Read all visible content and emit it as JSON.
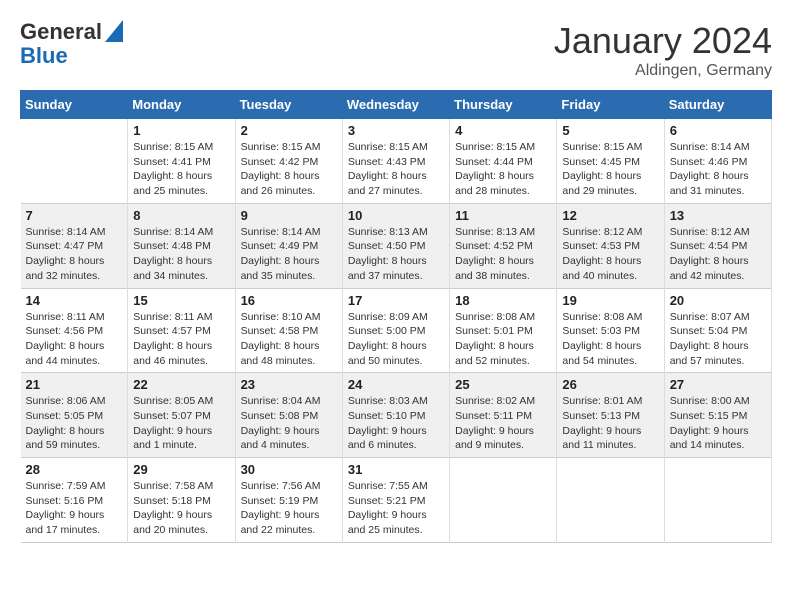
{
  "logo": {
    "general": "General",
    "blue": "Blue"
  },
  "header": {
    "month": "January 2024",
    "location": "Aldingen, Germany"
  },
  "days_of_week": [
    "Sunday",
    "Monday",
    "Tuesday",
    "Wednesday",
    "Thursday",
    "Friday",
    "Saturday"
  ],
  "weeks": [
    {
      "row_class": "week-row-1",
      "days": [
        {
          "num": "",
          "info": ""
        },
        {
          "num": "1",
          "info": "Sunrise: 8:15 AM\nSunset: 4:41 PM\nDaylight: 8 hours\nand 25 minutes."
        },
        {
          "num": "2",
          "info": "Sunrise: 8:15 AM\nSunset: 4:42 PM\nDaylight: 8 hours\nand 26 minutes."
        },
        {
          "num": "3",
          "info": "Sunrise: 8:15 AM\nSunset: 4:43 PM\nDaylight: 8 hours\nand 27 minutes."
        },
        {
          "num": "4",
          "info": "Sunrise: 8:15 AM\nSunset: 4:44 PM\nDaylight: 8 hours\nand 28 minutes."
        },
        {
          "num": "5",
          "info": "Sunrise: 8:15 AM\nSunset: 4:45 PM\nDaylight: 8 hours\nand 29 minutes."
        },
        {
          "num": "6",
          "info": "Sunrise: 8:14 AM\nSunset: 4:46 PM\nDaylight: 8 hours\nand 31 minutes."
        }
      ]
    },
    {
      "row_class": "week-row-2",
      "days": [
        {
          "num": "7",
          "info": "Sunrise: 8:14 AM\nSunset: 4:47 PM\nDaylight: 8 hours\nand 32 minutes."
        },
        {
          "num": "8",
          "info": "Sunrise: 8:14 AM\nSunset: 4:48 PM\nDaylight: 8 hours\nand 34 minutes."
        },
        {
          "num": "9",
          "info": "Sunrise: 8:14 AM\nSunset: 4:49 PM\nDaylight: 8 hours\nand 35 minutes."
        },
        {
          "num": "10",
          "info": "Sunrise: 8:13 AM\nSunset: 4:50 PM\nDaylight: 8 hours\nand 37 minutes."
        },
        {
          "num": "11",
          "info": "Sunrise: 8:13 AM\nSunset: 4:52 PM\nDaylight: 8 hours\nand 38 minutes."
        },
        {
          "num": "12",
          "info": "Sunrise: 8:12 AM\nSunset: 4:53 PM\nDaylight: 8 hours\nand 40 minutes."
        },
        {
          "num": "13",
          "info": "Sunrise: 8:12 AM\nSunset: 4:54 PM\nDaylight: 8 hours\nand 42 minutes."
        }
      ]
    },
    {
      "row_class": "week-row-3",
      "days": [
        {
          "num": "14",
          "info": "Sunrise: 8:11 AM\nSunset: 4:56 PM\nDaylight: 8 hours\nand 44 minutes."
        },
        {
          "num": "15",
          "info": "Sunrise: 8:11 AM\nSunset: 4:57 PM\nDaylight: 8 hours\nand 46 minutes."
        },
        {
          "num": "16",
          "info": "Sunrise: 8:10 AM\nSunset: 4:58 PM\nDaylight: 8 hours\nand 48 minutes."
        },
        {
          "num": "17",
          "info": "Sunrise: 8:09 AM\nSunset: 5:00 PM\nDaylight: 8 hours\nand 50 minutes."
        },
        {
          "num": "18",
          "info": "Sunrise: 8:08 AM\nSunset: 5:01 PM\nDaylight: 8 hours\nand 52 minutes."
        },
        {
          "num": "19",
          "info": "Sunrise: 8:08 AM\nSunset: 5:03 PM\nDaylight: 8 hours\nand 54 minutes."
        },
        {
          "num": "20",
          "info": "Sunrise: 8:07 AM\nSunset: 5:04 PM\nDaylight: 8 hours\nand 57 minutes."
        }
      ]
    },
    {
      "row_class": "week-row-4",
      "days": [
        {
          "num": "21",
          "info": "Sunrise: 8:06 AM\nSunset: 5:05 PM\nDaylight: 8 hours\nand 59 minutes."
        },
        {
          "num": "22",
          "info": "Sunrise: 8:05 AM\nSunset: 5:07 PM\nDaylight: 9 hours\nand 1 minute."
        },
        {
          "num": "23",
          "info": "Sunrise: 8:04 AM\nSunset: 5:08 PM\nDaylight: 9 hours\nand 4 minutes."
        },
        {
          "num": "24",
          "info": "Sunrise: 8:03 AM\nSunset: 5:10 PM\nDaylight: 9 hours\nand 6 minutes."
        },
        {
          "num": "25",
          "info": "Sunrise: 8:02 AM\nSunset: 5:11 PM\nDaylight: 9 hours\nand 9 minutes."
        },
        {
          "num": "26",
          "info": "Sunrise: 8:01 AM\nSunset: 5:13 PM\nDaylight: 9 hours\nand 11 minutes."
        },
        {
          "num": "27",
          "info": "Sunrise: 8:00 AM\nSunset: 5:15 PM\nDaylight: 9 hours\nand 14 minutes."
        }
      ]
    },
    {
      "row_class": "week-row-5",
      "days": [
        {
          "num": "28",
          "info": "Sunrise: 7:59 AM\nSunset: 5:16 PM\nDaylight: 9 hours\nand 17 minutes."
        },
        {
          "num": "29",
          "info": "Sunrise: 7:58 AM\nSunset: 5:18 PM\nDaylight: 9 hours\nand 20 minutes."
        },
        {
          "num": "30",
          "info": "Sunrise: 7:56 AM\nSunset: 5:19 PM\nDaylight: 9 hours\nand 22 minutes."
        },
        {
          "num": "31",
          "info": "Sunrise: 7:55 AM\nSunset: 5:21 PM\nDaylight: 9 hours\nand 25 minutes."
        },
        {
          "num": "",
          "info": ""
        },
        {
          "num": "",
          "info": ""
        },
        {
          "num": "",
          "info": ""
        }
      ]
    }
  ]
}
